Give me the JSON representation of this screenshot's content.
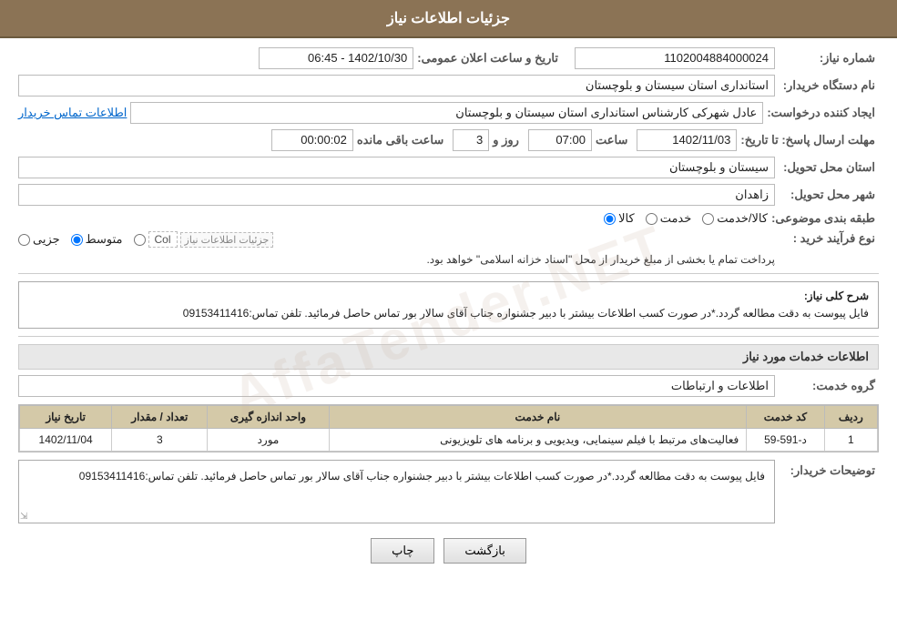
{
  "page": {
    "title": "جزئیات اطلاعات نیاز",
    "watermark": "AffaTender.NET"
  },
  "header": {
    "label_need_number": "شماره نیاز:",
    "need_number": "1102004884000024",
    "label_announce_date": "تاریخ و ساعت اعلان عمومی:",
    "announce_date": "1402/10/30 - 06:45",
    "label_buyer_name": "نام دستگاه خریدار:",
    "buyer_name": "استانداری استان سیستان و بلوچستان",
    "label_creator": "ایجاد کننده درخواست:",
    "creator_name": "عادل شهرکی کارشناس استانداری استان سیستان و بلوچستان",
    "contact_link": "اطلاعات تماس خریدار",
    "label_deadline": "مهلت ارسال پاسخ: تا تاریخ:",
    "deadline_date": "1402/11/03",
    "deadline_time_label": "ساعت",
    "deadline_time": "07:00",
    "deadline_days_label": "روز و",
    "deadline_days": "3",
    "deadline_remaining_label": "ساعت باقی مانده",
    "deadline_remaining": "00:00:02",
    "label_province": "استان محل تحویل:",
    "province": "سیستان و بلوچستان",
    "label_city": "شهر محل تحویل:",
    "city": "زاهدان",
    "label_category": "طبقه بندی موضوعی:",
    "category_options": [
      {
        "label": "کالا",
        "value": "kala",
        "selected": true
      },
      {
        "label": "خدمت",
        "value": "khedmat",
        "selected": false
      },
      {
        "label": "کالا/خدمت",
        "value": "kala_khedmat",
        "selected": false
      }
    ],
    "label_process_type": "نوع فرآیند خرید :",
    "process_options": [
      {
        "label": "جزیی",
        "value": "joz",
        "selected": false
      },
      {
        "label": "متوسط",
        "value": "motavasset",
        "selected": true
      },
      {
        "label": "Col",
        "value": "col",
        "selected": false
      }
    ],
    "process_note": "پرداخت تمام یا بخشی از مبلغ خریدار از محل \"اسناد خزانه اسلامی\" خواهد بود."
  },
  "description": {
    "section_title": "شرح کلی نیاز:",
    "text": "فایل پیوست به دقت مطالعه گردد.*در صورت کسب اطلاعات بیشتر با دبیر جشنواره جناب آقای سالار بور تماس حاصل فرمائید. تلفن تماس:09153411416"
  },
  "services": {
    "section_title": "اطلاعات خدمات مورد نیاز",
    "label_service_group": "گروه خدمت:",
    "service_group": "اطلاعات و ارتباطات",
    "table": {
      "headers": [
        "ردیف",
        "کد خدمت",
        "نام خدمت",
        "واحد اندازه گیری",
        "تعداد / مقدار",
        "تاریخ نیاز"
      ],
      "rows": [
        {
          "row": "1",
          "code": "د-591-59",
          "name": "فعالیت‌های مرتبط با فیلم سینمایی، ویدیویی و برنامه های تلویزیونی",
          "unit": "مورد",
          "count": "3",
          "date": "1402/11/04"
        }
      ]
    }
  },
  "buyer_notes": {
    "label": "توضیحات خریدار:",
    "text": "فایل پیوست به دقت مطالعه گردد.*در صورت کسب اطلاعات بیشتر با دبیر جشنواره جناب آقای سالار بور تماس حاصل فرمائید. تلفن تماس:09153411416"
  },
  "buttons": {
    "print": "چاپ",
    "back": "بازگشت"
  }
}
